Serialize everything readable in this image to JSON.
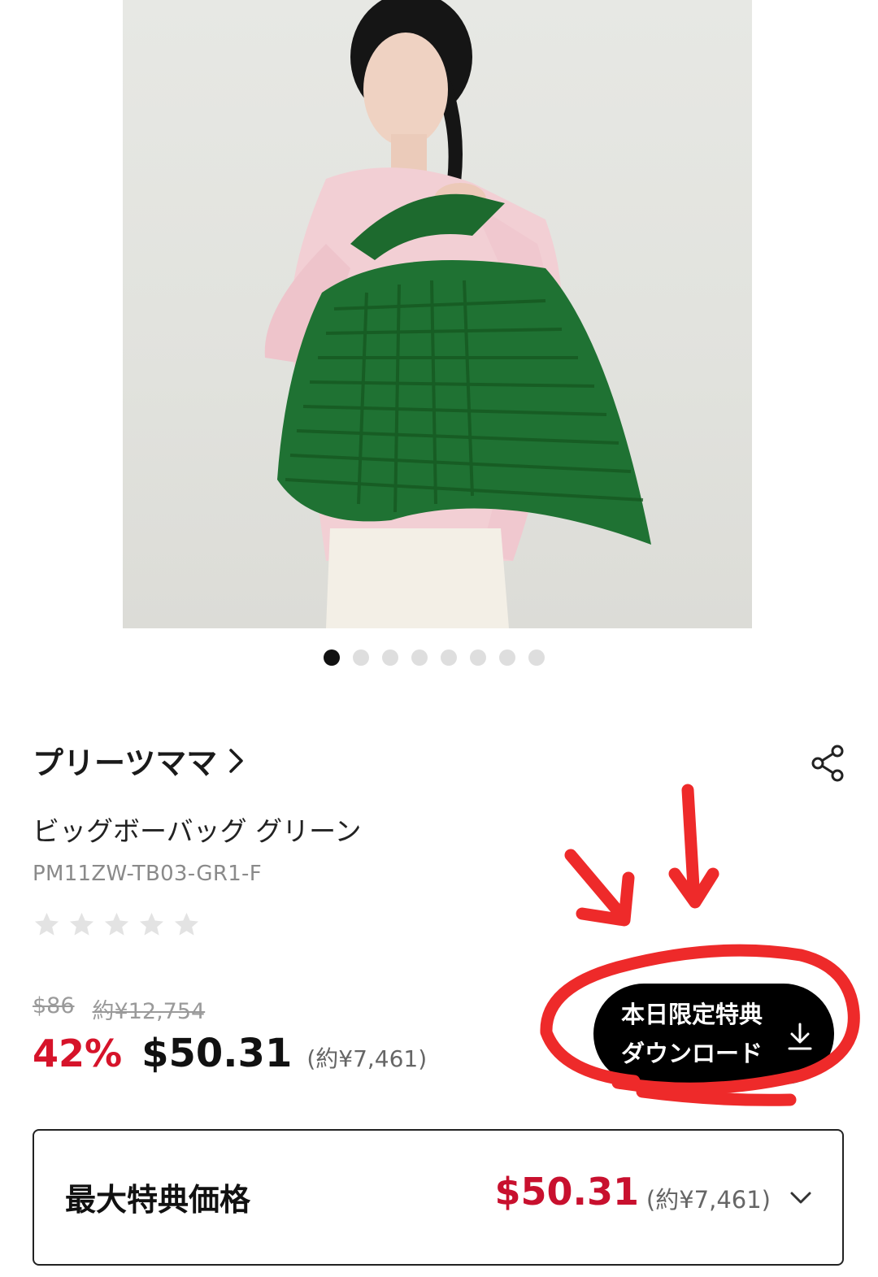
{
  "brand": {
    "name": "プリーツママ",
    "icon": "chevron-right-icon"
  },
  "product": {
    "name": "ビッグボーバッグ グリーン",
    "sku": "PM11ZW-TB03-GR1-F",
    "rating": 0,
    "rating_max": 5
  },
  "carousel": {
    "count": 8,
    "active_index": 0
  },
  "pricing": {
    "original_usd": "$86",
    "original_jpy": "約¥12,754",
    "discount": "42%",
    "price_usd": "$50.31",
    "price_jpy": "(約¥7,461)"
  },
  "coupon": {
    "line1": "本日限定特典",
    "line2": "ダウンロード",
    "icon": "download-icon"
  },
  "best_price": {
    "label": "最大特典価格",
    "price_usd": "$50.31",
    "price_jpy": "(約¥7,461)",
    "icon": "chevron-down-icon"
  },
  "colors": {
    "accent_red": "#d6132a",
    "coupon_bg": "#000000",
    "annotation_red": "#ee2a2a"
  }
}
